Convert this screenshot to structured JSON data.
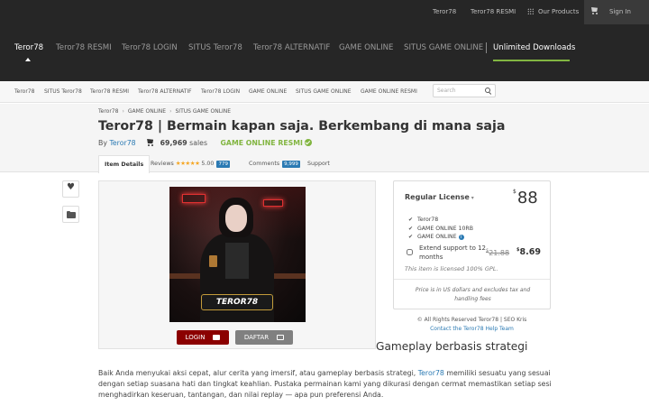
{
  "topbar": {
    "links": [
      "Teror78",
      "Teror78 RESMI"
    ],
    "products_label": "Our Products",
    "signin_label": "Sign In",
    "icons": [
      "grid-icon",
      "cart-icon"
    ]
  },
  "mainnav": {
    "items": [
      "Teror78",
      "Teror78 RESMI",
      "Teror78 LOGIN",
      "SITUS Teror78",
      "Teror78 ALTERNATIF",
      "GAME ONLINE",
      "SITUS GAME ONLINE"
    ],
    "unlimited": "Unlimited Downloads",
    "accent": "#82b541"
  },
  "catbar": {
    "items": [
      "Teror78",
      "SITUS Teror78",
      "Teror78 RESMI",
      "Teror78 ALTERNATIF",
      "Teror78 LOGIN",
      "GAME ONLINE",
      "SITUS GAME ONLINE",
      "GAME ONLINE RESMI"
    ],
    "search_placeholder": "Search"
  },
  "header": {
    "breadcrumb": [
      "Teror78",
      "GAME ONLINE",
      "SITUS GAME ONLINE"
    ],
    "title": "Teror78 | Bermain kapan saja. Berkembang di mana saja",
    "by": "By",
    "author": "Teror78",
    "sales_count": "69,969",
    "sales_word": "sales",
    "badge": "GAME ONLINE RESMI",
    "tabs": {
      "details": "Item Details",
      "reviews": "Reviews",
      "stars": "★★★★★",
      "rating": "5.00",
      "reviews_count": "779",
      "comments": "Comments",
      "comments_count": "9,999",
      "support": "Support"
    }
  },
  "preview": {
    "plate_text": "TEROR78",
    "login_label": "LOGIN",
    "daftar_label": "DAFTAR"
  },
  "license": {
    "name": "Regular License",
    "currency": "$",
    "price": "88",
    "features": [
      "Teror78",
      "GAME ONLINE 10RB",
      "GAME ONLINE"
    ],
    "extend_label": "Extend support to 12 months",
    "old_price": "21.88",
    "new_price": "8.69",
    "gpl_note": "This item is licensed 100% GPL.",
    "tax_note": "Price is in US dollars and excludes tax and handling fees"
  },
  "rights": {
    "text": "© All Rights Reserved Teror78 | SEO Kris",
    "help": "Contact the Teror78 Help Team"
  },
  "content": {
    "heading": "Gameplay berbasis strategi",
    "para_before": "Baik Anda menyukai aksi cepat, alur cerita yang imersif, atau gameplay berbasis strategi, ",
    "para_link": "Teror78",
    "para_after": " memiliki sesuatu yang sesuai dengan setiap suasana hati dan tingkat keahlian. Pustaka permainan kami yang dikurasi dengan cermat memastikan setiap sesi menghadirkan keseruan, tantangan, dan nilai replay — apa pun preferensi Anda."
  }
}
